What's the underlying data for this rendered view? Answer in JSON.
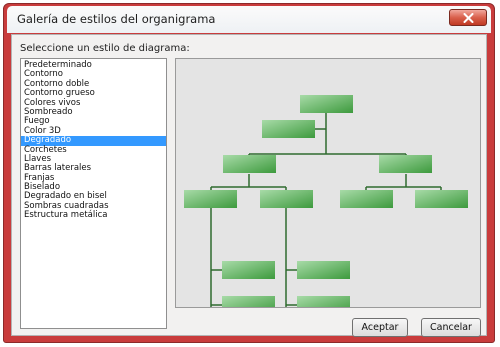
{
  "window": {
    "title": "Galería de estilos del organigrama"
  },
  "controls": {
    "close_icon": "close-x-icon"
  },
  "style_picker": {
    "label": "Seleccione un estilo de diagrama:",
    "items": [
      "Predeterminado",
      "Contorno",
      "Contorno doble",
      "Contorno grueso",
      "Colores vivos",
      "Sombreado",
      "Fuego",
      "Color 3D",
      "Degradado",
      "Corchetes",
      "Llaves",
      "Barras laterales",
      "Franjas",
      "Biselado",
      "Degradado en bisel",
      "Sombras cuadradas",
      "Estructura metálica"
    ],
    "selected_index": 8
  },
  "preview": {
    "box_color_light": "#a8dba8",
    "box_color_dark": "#3d9a3d",
    "connector_color": "#2e6b2e"
  },
  "buttons": {
    "ok": "Aceptar",
    "cancel": "Cancelar"
  }
}
